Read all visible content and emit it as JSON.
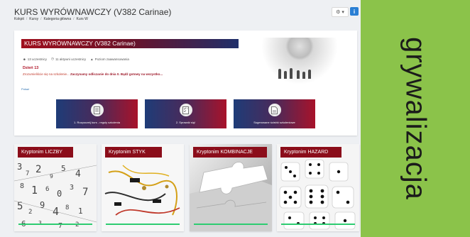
{
  "header": {
    "title": "KURS WYRÓWNAWCZY (V382 Carinae)",
    "breadcrumb": [
      "Kokpit",
      "Kursy",
      "Kategoria główna",
      "Kurs W"
    ]
  },
  "course": {
    "title": "KURS WYRÓWNAWCZY (V382 Carinae)",
    "stats": [
      "13 uczestnicy",
      "11 aktywni uczestnicy",
      "Poziom zaawansowania"
    ],
    "day_label": "Dzień 13",
    "day_text_plain": "Zrozumieliście się na szkolenie...",
    "day_text_bold": "Zaczynamy odliczanie do dnia 0. Bądź gotowy na wszystko...",
    "more_link": "Pokaż"
  },
  "actions": [
    {
      "label": "1. Rozpocznij kurs - reguły szkolenia",
      "icon": "document-icon"
    },
    {
      "label": "2. Sprawdź się!",
      "icon": "checklist-icon"
    },
    {
      "label": "Sugerowane ścieżki szkoleniowe",
      "icon": "file-icon"
    }
  ],
  "tiles": [
    {
      "title": "Kryptonim LICZBY",
      "progress": 1.0
    },
    {
      "title": "Kryptonim STYK",
      "progress": 1.0
    },
    {
      "title": "Kryptonim KOMBINACJE",
      "progress": 1.0
    },
    {
      "title": "Kryptonim HAZARD",
      "progress": 1.0
    }
  ],
  "side_label": "grywalizacja",
  "colors": {
    "accent_red": "#8b0d1a",
    "accent_blue": "#1e3c78",
    "side_green": "#8bc34a",
    "progress_green": "#2ecc71"
  }
}
